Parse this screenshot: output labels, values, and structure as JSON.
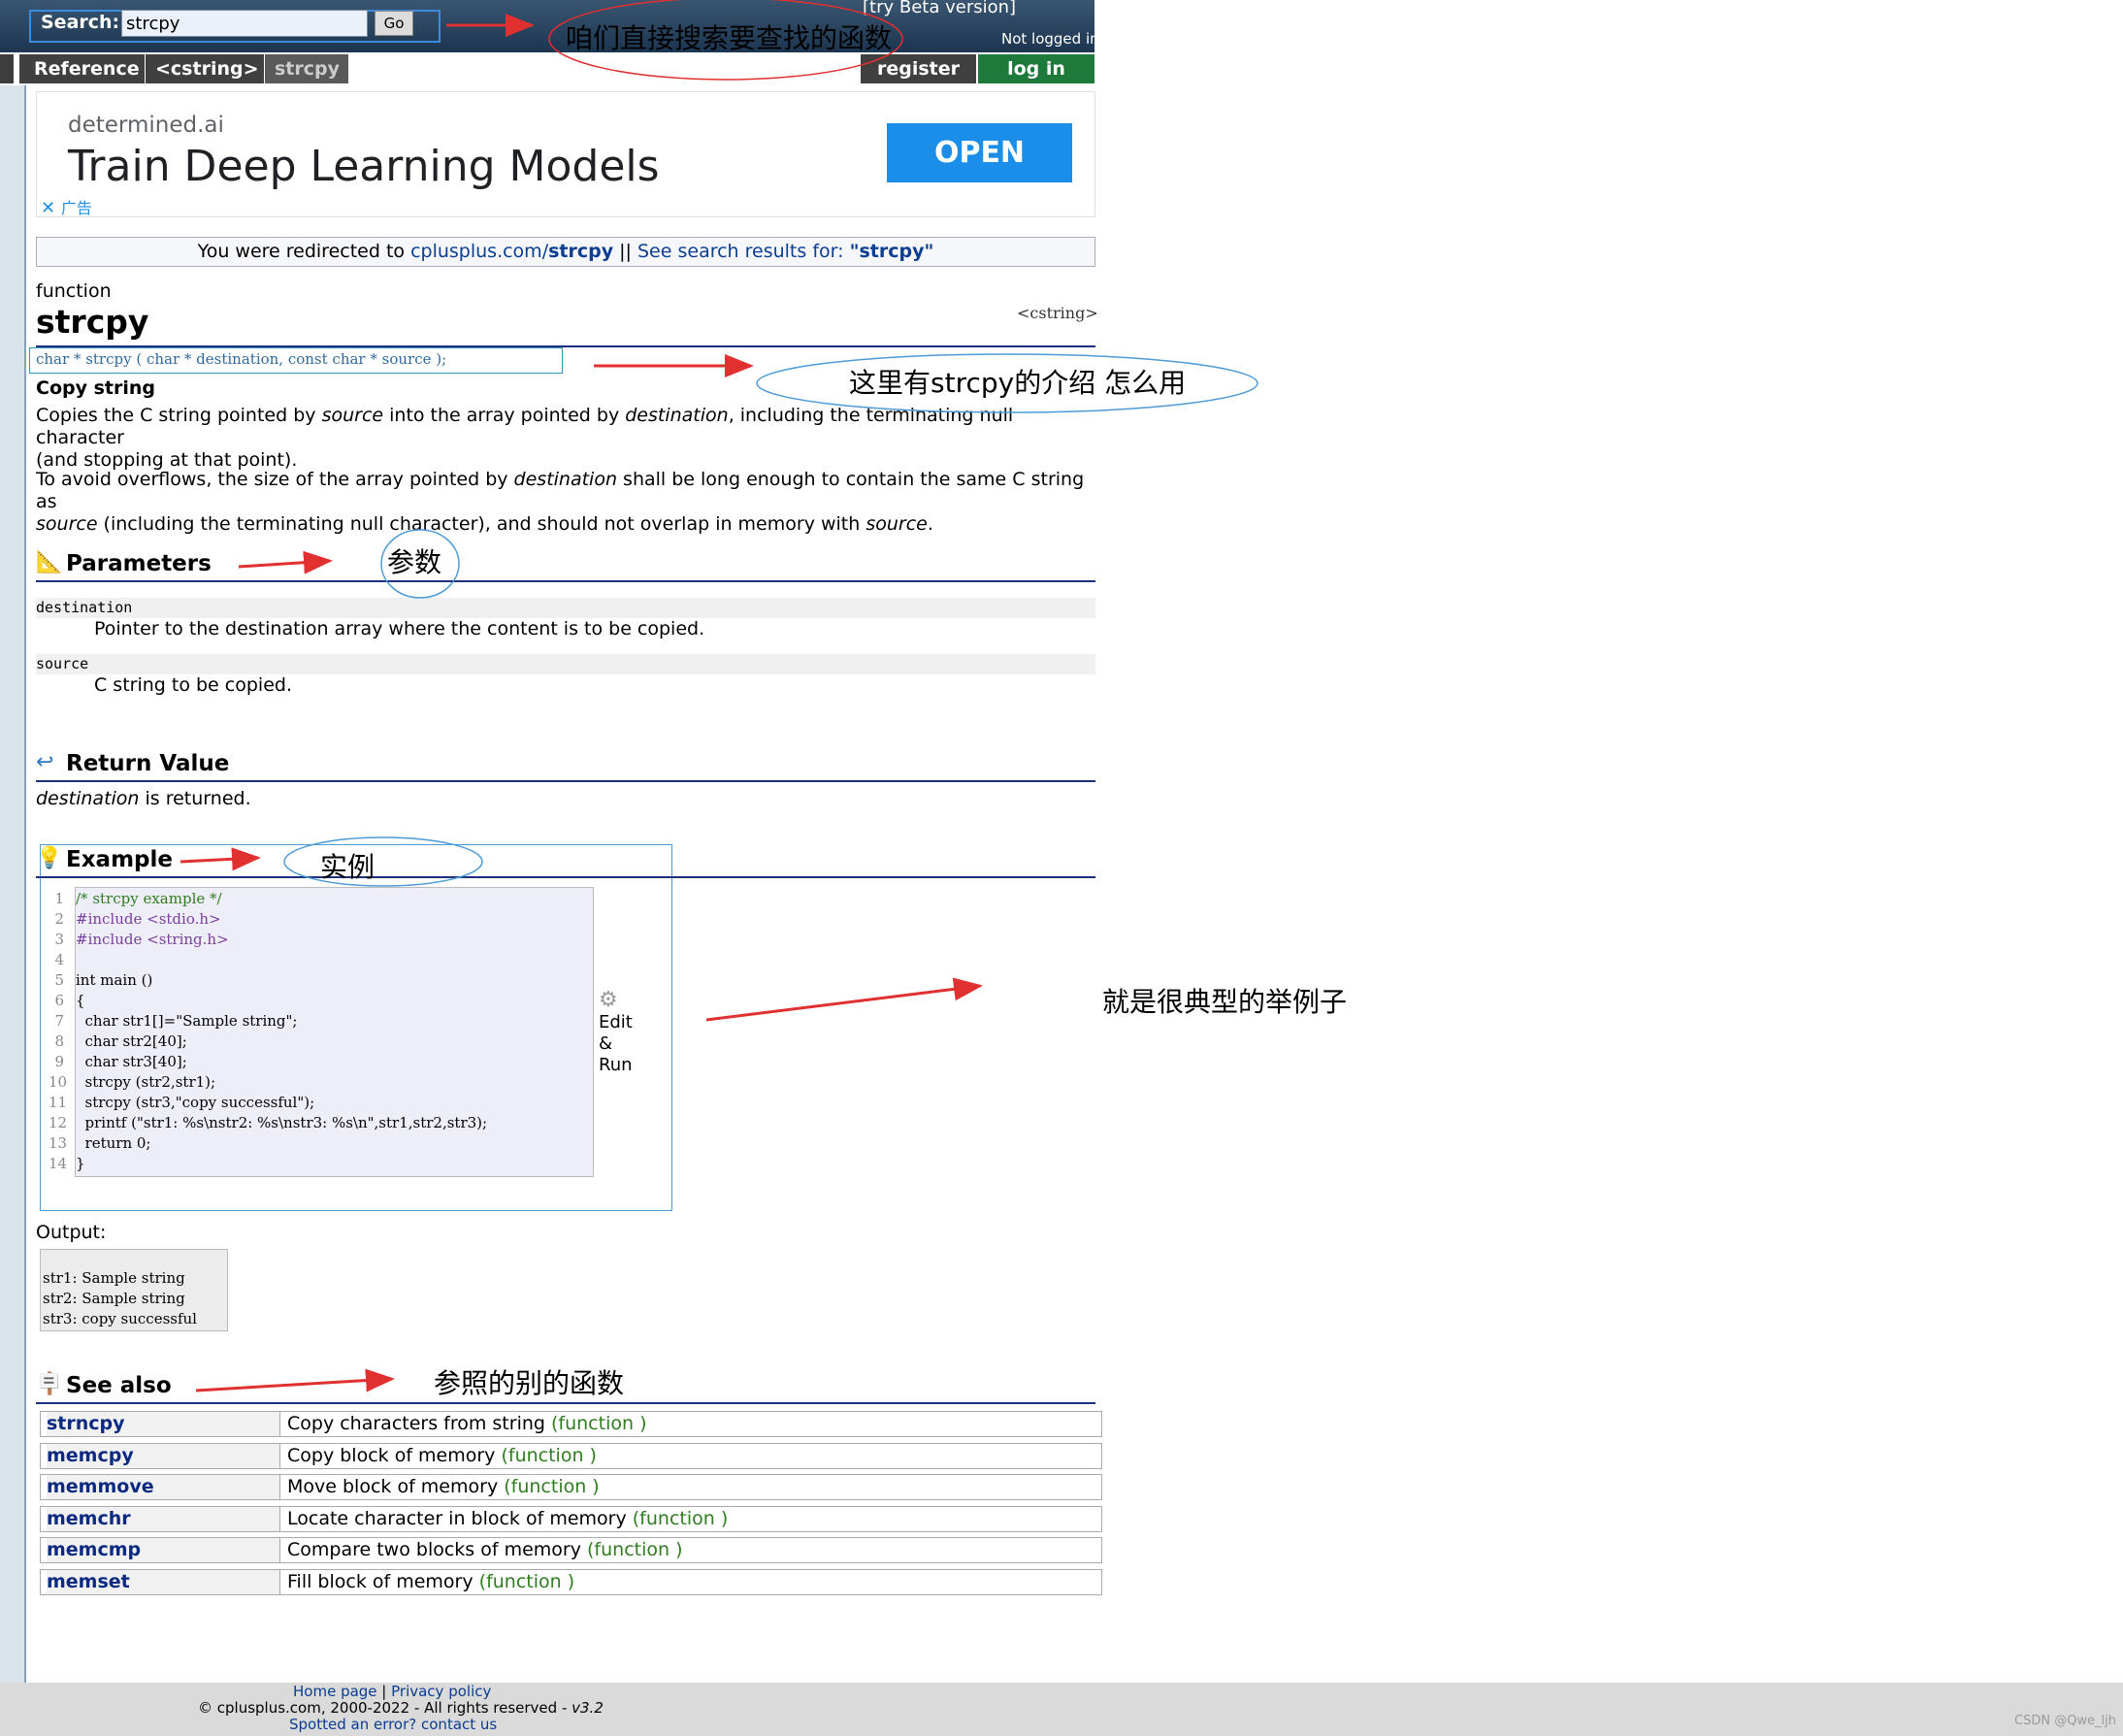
{
  "header": {
    "search_label": "Search:",
    "search_value": "strcpy",
    "go_label": "Go",
    "beta_link": "[try Beta version]",
    "login_status": "Not logged in"
  },
  "breadcrumb": [
    "Reference",
    "<cstring>",
    "strcpy"
  ],
  "auth": {
    "register": "register",
    "login": "log in"
  },
  "ad": {
    "brand": "determined.ai",
    "title": "Train Deep Learning Models",
    "cta": "OPEN",
    "close": "广告"
  },
  "redirect": {
    "prefix": "You were redirected to ",
    "url_host": "cplusplus.com/",
    "url_path": "strcpy",
    "sep": " || ",
    "search_text": "See search results for: ",
    "search_term": "\"strcpy\""
  },
  "doc": {
    "kind": "function",
    "name": "strcpy",
    "header_tag": "<cstring>",
    "signature": "char * strcpy ( char * destination, const char * source );",
    "summary": "Copy string",
    "desc1_a": "Copies the C string pointed by ",
    "desc1_b": "source",
    "desc1_c": " into the array pointed by ",
    "desc1_d": "destination",
    "desc1_e": ", including the terminating null character",
    "desc1_f": "(and stopping at that point).",
    "desc2_a": "To avoid overflows, the size of the array pointed by ",
    "desc2_b": "destination",
    "desc2_c": " shall be long enough to contain the same C string as",
    "desc2_d": "source",
    "desc2_e": " (including the terminating null character), and should not overlap in memory with ",
    "desc2_f": "source",
    "desc2_g": ".",
    "parameters_title": "Parameters",
    "params": [
      {
        "name": "destination",
        "desc": "Pointer to the destination array where the content is to be copied."
      },
      {
        "name": "source",
        "desc": "C string to be copied."
      }
    ],
    "return_title": "Return Value",
    "return_a": "destination",
    "return_b": " is returned.",
    "example_title": "Example",
    "code": [
      "/* strcpy example */",
      "#include <stdio.h>",
      "#include <string.h>",
      "",
      "int main ()",
      "{",
      "  char str1[]=\"Sample string\";",
      "  char str2[40];",
      "  char str3[40];",
      "  strcpy (str2,str1);",
      "  strcpy (str3,\"copy successful\");",
      "  printf (\"str1: %s\\nstr2: %s\\nstr3: %s\\n\",str1,str2,str3);",
      "  return 0;",
      "}"
    ],
    "line_numbers": [
      "1",
      "2",
      "3",
      "4",
      "5",
      "6",
      "7",
      "8",
      "9",
      "10",
      "11",
      "12",
      "13",
      "14"
    ],
    "edit_run": [
      "Edit",
      "&",
      "Run"
    ],
    "output_label": "Output:",
    "output": [
      "str1: Sample string",
      "str2: Sample string",
      "str3: copy successful"
    ],
    "see_also_title": "See also",
    "see_also": [
      {
        "name": "strncpy",
        "desc": "Copy characters from string ",
        "kind": "(function )"
      },
      {
        "name": "memcpy",
        "desc": "Copy block of memory ",
        "kind": "(function )"
      },
      {
        "name": "memmove",
        "desc": "Move block of memory ",
        "kind": "(function )"
      },
      {
        "name": "memchr",
        "desc": "Locate character in block of memory ",
        "kind": "(function )"
      },
      {
        "name": "memcmp",
        "desc": "Compare two blocks of memory ",
        "kind": "(function )"
      },
      {
        "name": "memset",
        "desc": "Fill block of memory ",
        "kind": "(function )"
      }
    ]
  },
  "footer": {
    "home": "Home page",
    "sep": " | ",
    "privacy": "Privacy policy",
    "copyright": "© cplusplus.com, 2000-2022 - All rights reserved - ",
    "version": "v3.2",
    "error": "Spotted an error? contact us",
    "watermark": "CSDN @Qwe_ljh"
  },
  "annotations": {
    "search_note": "咱们直接搜索要查找的函数",
    "signature_note": "这里有strcpy的介绍 怎么用",
    "param_note": "参数",
    "example_note": "实例",
    "example_side_note": "就是很典型的举例子",
    "see_also_note": "参照的别的函数"
  },
  "colors": {
    "header": "#1c3550",
    "accent_link": "#0b3d91",
    "annotation_red": "#e03030",
    "annotation_blue": "#4c9bd6",
    "function_kind": "#2f7d1f"
  }
}
